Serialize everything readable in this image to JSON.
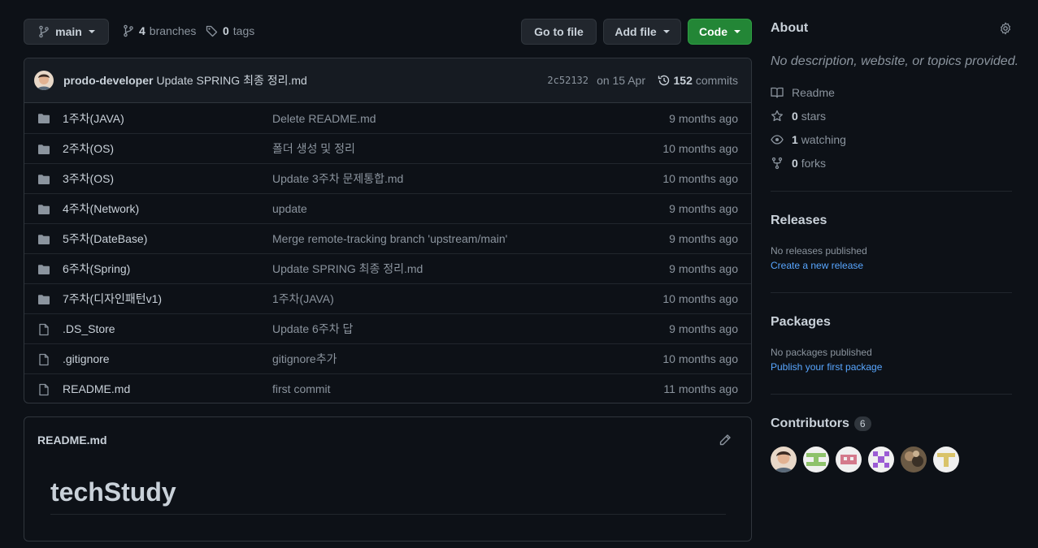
{
  "colors": {
    "accent": "#238636",
    "link": "#58a6ff",
    "bg": "#0d1117",
    "panel": "#161b22"
  },
  "toolbar": {
    "branch_label": "main",
    "branches_count": "4",
    "branches_label": "branches",
    "tags_count": "0",
    "tags_label": "tags",
    "go_to_file": "Go to file",
    "add_file": "Add file",
    "code": "Code"
  },
  "commit": {
    "author": "prodo-developer",
    "message": "Update SPRING 최종 정리.md",
    "sha": "2c52132",
    "date": "on 15 Apr",
    "commits_count": "152",
    "commits_label": "commits"
  },
  "files": [
    {
      "icon": "folder-icon",
      "name": "1주차(JAVA)",
      "message": "Delete README.md",
      "age": "9 months ago"
    },
    {
      "icon": "folder-icon",
      "name": "2주차(OS)",
      "message": "폴더 생성 및 정리",
      "age": "10 months ago"
    },
    {
      "icon": "folder-icon",
      "name": "3주차(OS)",
      "message": "Update 3주차 문제통합.md",
      "age": "10 months ago"
    },
    {
      "icon": "folder-icon",
      "name": "4주차(Network)",
      "message": "update",
      "age": "9 months ago"
    },
    {
      "icon": "folder-icon",
      "name": "5주차(DateBase)",
      "message": "Merge remote-tracking branch 'upstream/main'",
      "age": "9 months ago"
    },
    {
      "icon": "folder-icon",
      "name": "6주차(Spring)",
      "message": "Update SPRING 최종 정리.md",
      "age": "9 months ago"
    },
    {
      "icon": "folder-icon",
      "name": "7주차(디자인패턴v1)",
      "message": "1주차(JAVA)",
      "age": "10 months ago"
    },
    {
      "icon": "file-icon",
      "name": ".DS_Store",
      "message": "Update 6주차 답",
      "age": "9 months ago"
    },
    {
      "icon": "file-icon",
      "name": ".gitignore",
      "message": "gitignore추가",
      "age": "10 months ago"
    },
    {
      "icon": "file-icon",
      "name": "README.md",
      "message": "first commit",
      "age": "11 months ago"
    }
  ],
  "readme": {
    "filename": "README.md",
    "heading": "techStudy"
  },
  "about": {
    "title": "About",
    "description": "No description, website, or topics provided.",
    "readme_label": "Readme",
    "stars_count": "0",
    "stars_label": "stars",
    "watching_count": "1",
    "watching_label": "watching",
    "forks_count": "0",
    "forks_label": "forks"
  },
  "releases": {
    "title": "Releases",
    "empty": "No releases published",
    "link": "Create a new release"
  },
  "packages": {
    "title": "Packages",
    "empty": "No packages published",
    "link": "Publish your first package"
  },
  "contributors": {
    "title": "Contributors",
    "count": "6"
  }
}
